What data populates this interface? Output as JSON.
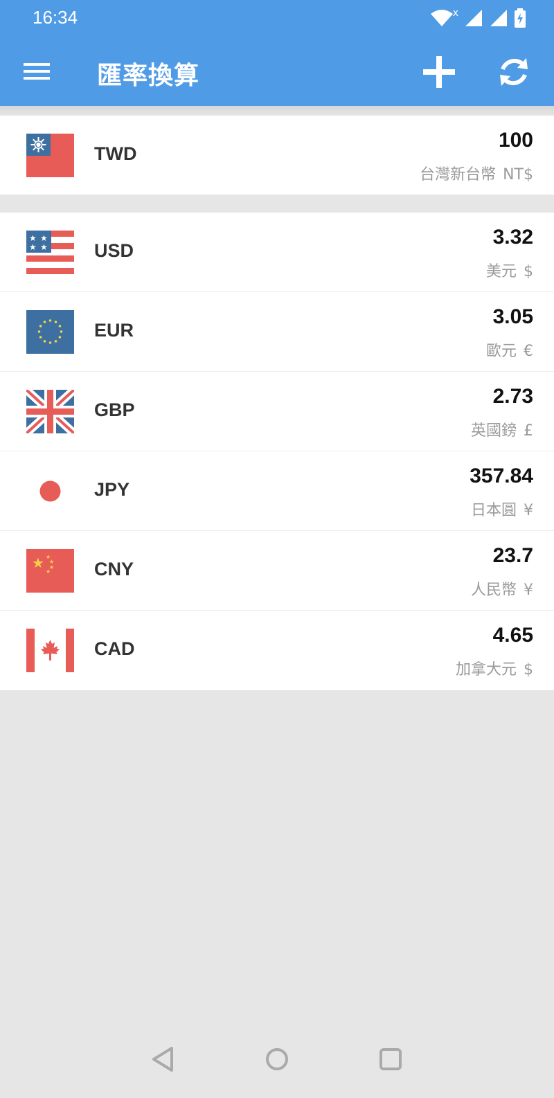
{
  "status_bar": {
    "time": "16:34"
  },
  "app_bar": {
    "title": "匯率換算"
  },
  "base_currency": {
    "code": "TWD",
    "amount": "100",
    "name": "台灣新台幣",
    "symbol": "NT$",
    "flag_icon": "taiwan-flag-icon"
  },
  "currencies": [
    {
      "code": "USD",
      "amount": "3.32",
      "name": "美元",
      "symbol": "$",
      "flag_icon": "usa-flag-icon"
    },
    {
      "code": "EUR",
      "amount": "3.05",
      "name": "歐元",
      "symbol": "€",
      "flag_icon": "eu-flag-icon"
    },
    {
      "code": "GBP",
      "amount": "2.73",
      "name": "英國鎊",
      "symbol": "£",
      "flag_icon": "uk-flag-icon"
    },
    {
      "code": "JPY",
      "amount": "357.84",
      "name": "日本圓",
      "symbol": "¥",
      "flag_icon": "japan-flag-icon"
    },
    {
      "code": "CNY",
      "amount": "23.7",
      "name": "人民幣",
      "symbol": "¥",
      "flag_icon": "china-flag-icon"
    },
    {
      "code": "CAD",
      "amount": "4.65",
      "name": "加拿大元",
      "symbol": "$",
      "flag_icon": "canada-flag-icon"
    }
  ],
  "colors": {
    "primary": "#4f9be6",
    "background": "#e6e6e6",
    "flag_red": "#e85c57",
    "flag_blue": "#3d6fa0"
  }
}
